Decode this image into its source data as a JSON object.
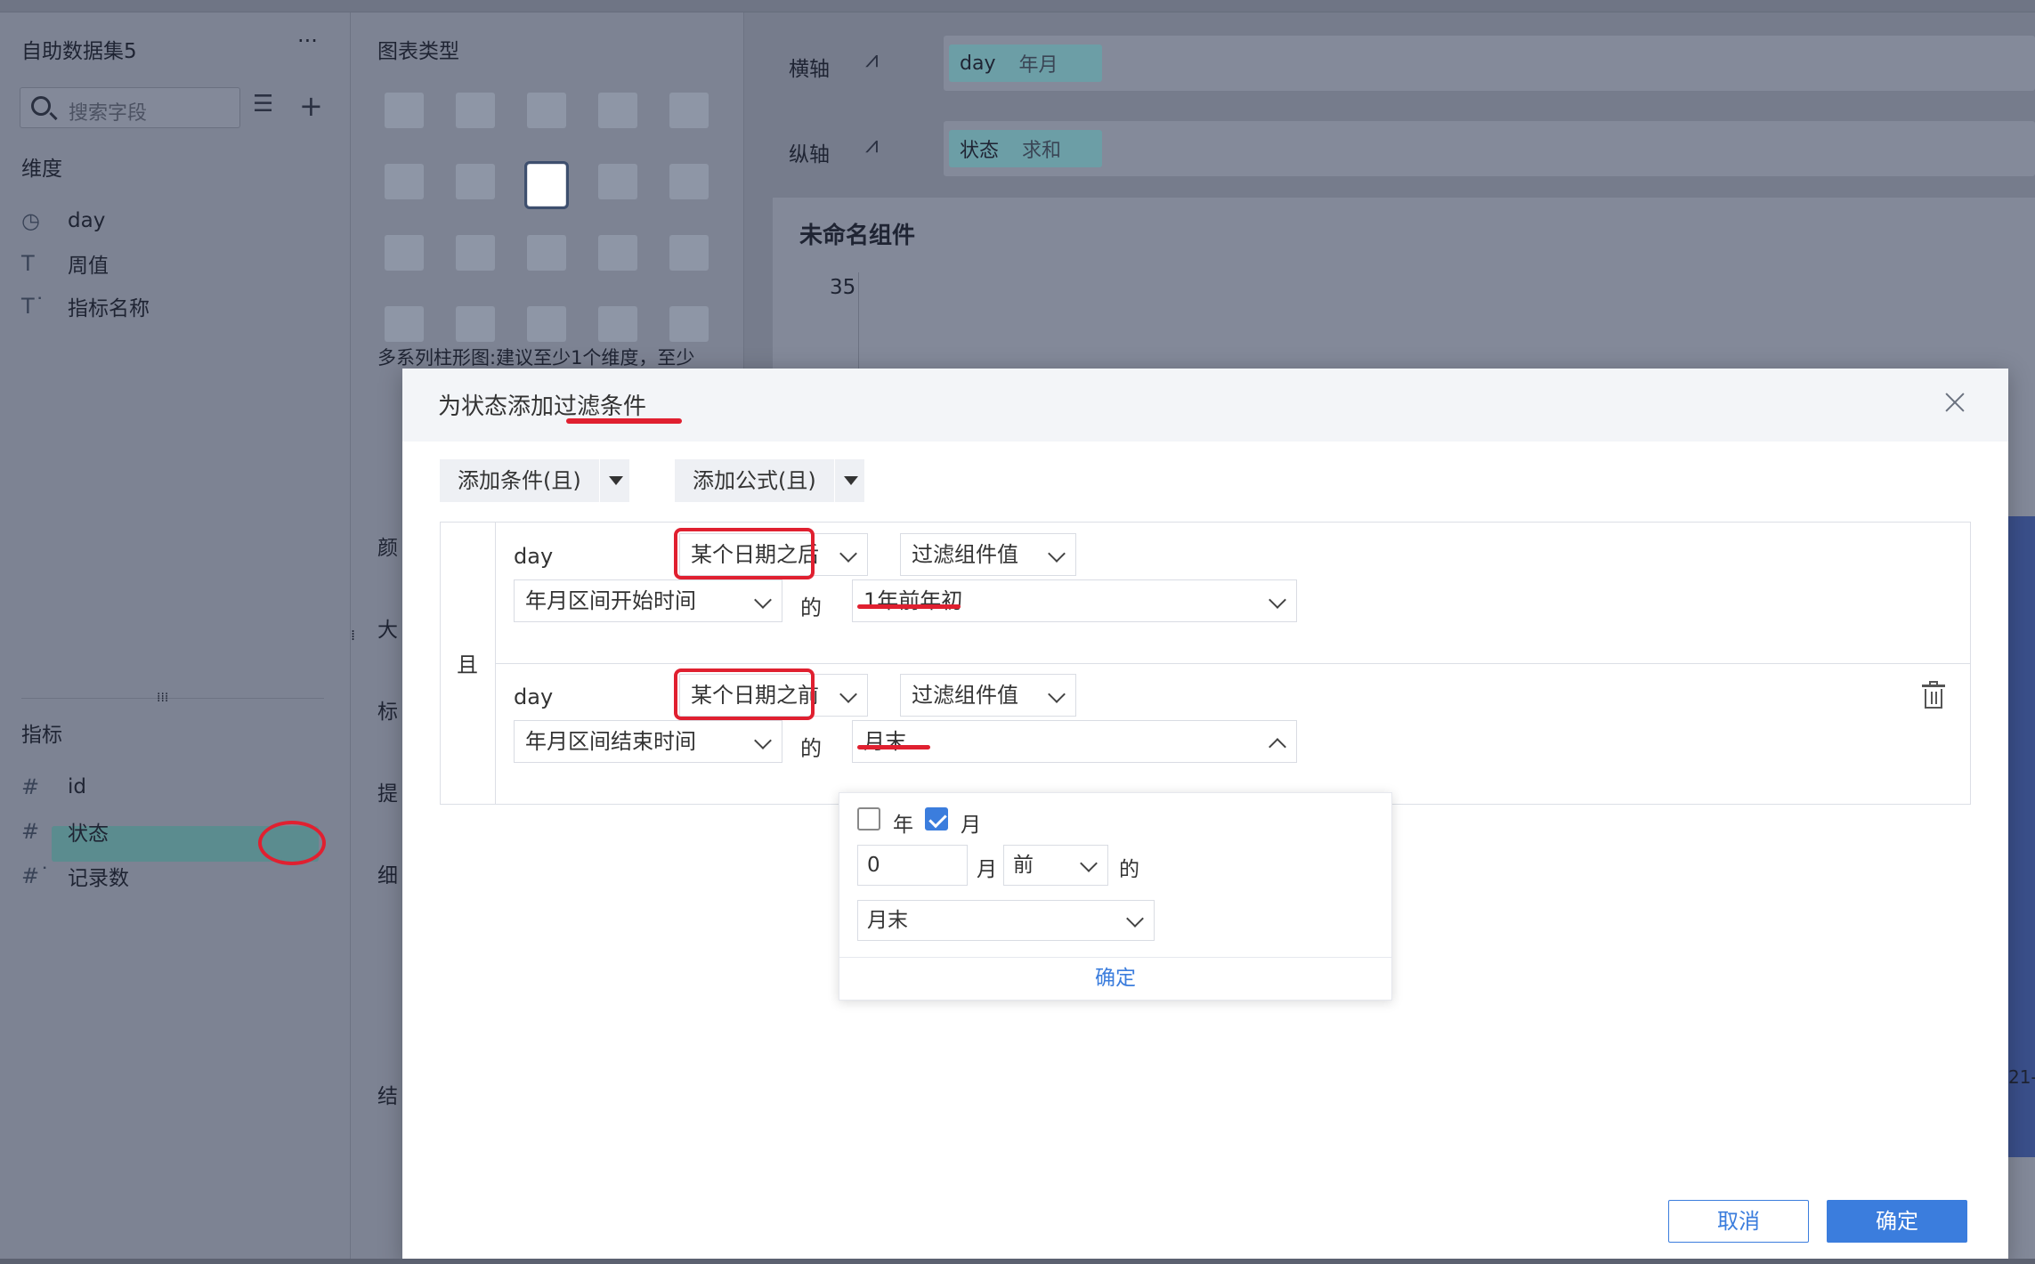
{
  "left_panel": {
    "dataset_title": "自助数据集5",
    "more_label": "···",
    "search_placeholder": "搜索字段",
    "dimension_header": "维度",
    "dimensions": [
      {
        "icon": "clock-icon",
        "glyph": "◷",
        "label": "day"
      },
      {
        "icon": "text-type-icon",
        "glyph": "T",
        "label": "周值"
      },
      {
        "icon": "text-type-icon",
        "glyph": "T˙",
        "label": "指标名称"
      }
    ],
    "measure_header": "指标",
    "measures": [
      {
        "icon": "number-type-icon",
        "glyph": "#",
        "label": "id"
      },
      {
        "icon": "number-type-icon",
        "glyph": "#",
        "label": "状态"
      },
      {
        "icon": "number-type-icon",
        "glyph": "#˙",
        "label": "记录数"
      }
    ]
  },
  "middle_panel": {
    "chart_type_header": "图表类型",
    "chart_hint": "多系列柱形图:建议至少1个维度，至少",
    "truncated_labels": [
      "颜",
      "大",
      "标",
      "提",
      "细",
      "结"
    ]
  },
  "right_area": {
    "x_axis_label": "横轴",
    "x_axis_field": "day",
    "x_axis_sub": "年月",
    "y_axis_label": "纵轴",
    "y_axis_field": "状态",
    "y_axis_sub": "求和",
    "component_title": "未命名组件",
    "y_tick_top": "35",
    "edge_text": "21-"
  },
  "modal": {
    "title_prefix": "为状态添加",
    "title_emph": "过滤条件",
    "add_condition_label": "添加条件(且)",
    "add_formula_label": "添加公式(且)",
    "and_label": "且",
    "conditions": [
      {
        "field": "day",
        "operator": "某个日期之后",
        "value_type": "过滤组件值",
        "range_field": "年月区间开始时间",
        "of_label": "的",
        "value": "1年前年初"
      },
      {
        "field": "day",
        "operator": "某个日期之前",
        "value_type": "过滤组件值",
        "range_field": "年月区间结束时间",
        "of_label": "的",
        "value": "月末"
      }
    ],
    "popup": {
      "year_label": "年",
      "year_checked": false,
      "month_label": "月",
      "month_checked": true,
      "offset_value": "0",
      "offset_unit": "月",
      "direction": "前",
      "of_label": "的",
      "position": "月末",
      "confirm_label": "确定"
    },
    "cancel_label": "取消",
    "ok_label": "确定"
  },
  "colors": {
    "accent": "#3b7ddd",
    "annotation_red": "#e02030",
    "dim_overlay": "#7b8294"
  }
}
